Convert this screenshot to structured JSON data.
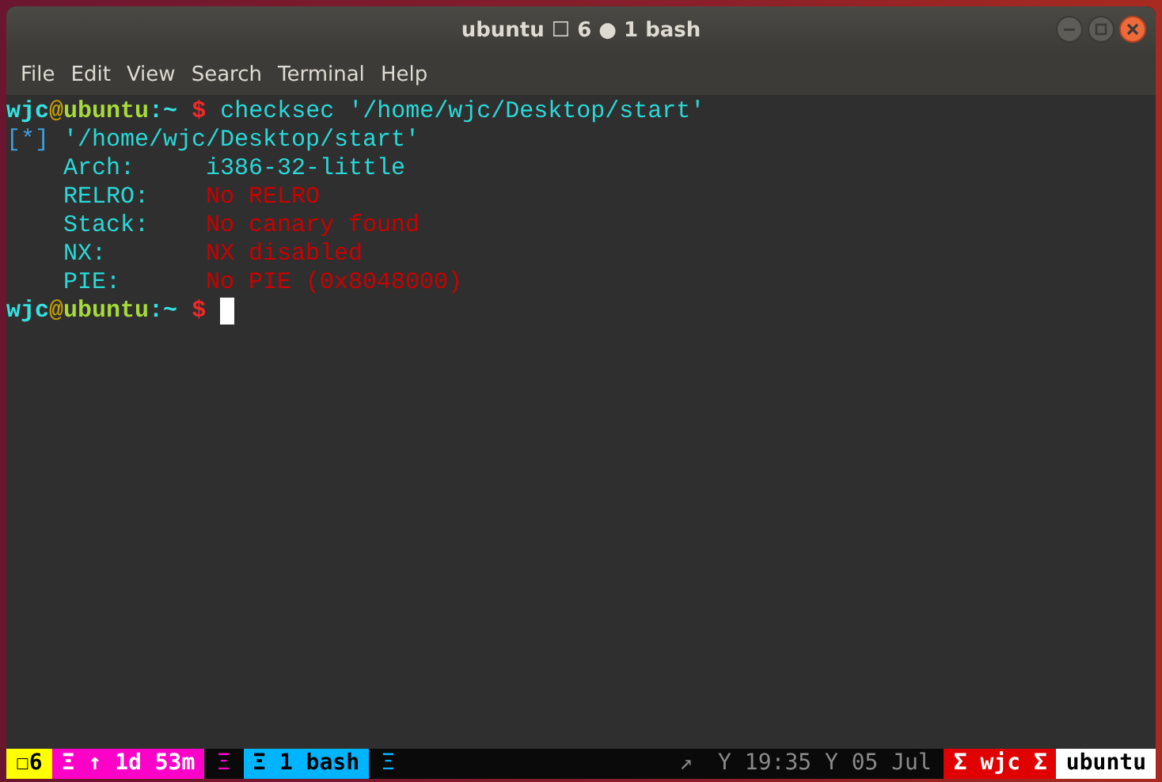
{
  "window": {
    "title": "ubuntu ☐ 6 ● 1 bash"
  },
  "menu": [
    {
      "label": "File"
    },
    {
      "label": "Edit"
    },
    {
      "label": "View"
    },
    {
      "label": "Search"
    },
    {
      "label": "Terminal"
    },
    {
      "label": "Help"
    }
  ],
  "terminal": {
    "lines": [
      {
        "kind": "prompt",
        "user": "wjc",
        "at": "@",
        "host": "ubuntu",
        "path": ":~",
        "symbol": "$",
        "command": "checksec '/home/wjc/Desktop/start'"
      },
      {
        "kind": "info",
        "marker": "[*]",
        "text": "'/home/wjc/Desktop/start'"
      },
      {
        "kind": "field",
        "label": "Arch:",
        "value": "i386-32-little",
        "color": "#2ad8d8"
      },
      {
        "kind": "field",
        "label": "RELRO:",
        "value": "No RELRO",
        "color": "#cc0000"
      },
      {
        "kind": "field",
        "label": "Stack:",
        "value": "No canary found",
        "color": "#cc0000"
      },
      {
        "kind": "field",
        "label": "NX:",
        "value": "NX disabled",
        "color": "#cc0000"
      },
      {
        "kind": "field",
        "label": "PIE:",
        "value": "No PIE (0x8048000)",
        "color": "#cc0000"
      },
      {
        "kind": "prompt",
        "user": "wjc",
        "at": "@",
        "host": "ubuntu",
        "path": ":~",
        "symbol": "$",
        "cursor": true
      }
    ]
  },
  "status_bar": {
    "left": [
      {
        "kind": "block",
        "text": "☐6",
        "color": "#ffff00"
      },
      {
        "kind": "block",
        "text": "Ξ ↑ 1d 53m",
        "color": "#ff00c8"
      },
      {
        "kind": "glyph",
        "text": "Ξ"
      },
      {
        "kind": "block",
        "text": "Ξ 1 bash",
        "color": "#00b4ff"
      },
      {
        "kind": "glyph",
        "text": "Ξ"
      }
    ],
    "right": [
      {
        "kind": "glyph",
        "text": "↗"
      },
      {
        "kind": "glyph",
        "text": "Y 19:35 Y 05 Jul"
      },
      {
        "kind": "block",
        "text": "Σ wjc Σ",
        "color": "#e00000"
      },
      {
        "kind": "block",
        "text": "ubuntu",
        "color": "#ffffff"
      }
    ]
  }
}
